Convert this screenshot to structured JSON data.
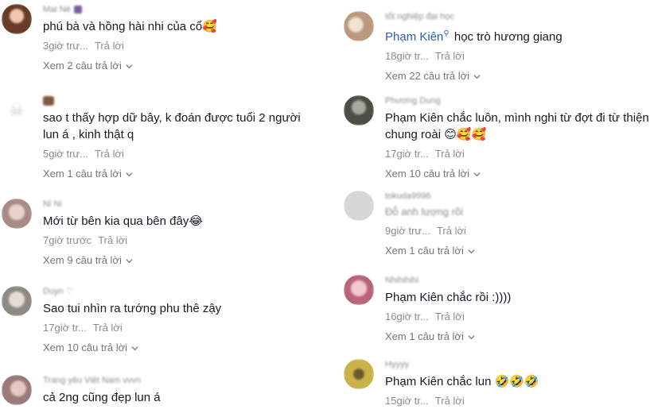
{
  "left_column": [
    {
      "username": "Mai Nè",
      "avatar_color": "#6b3b2a",
      "text": "phú bà và hồng hài nhi của cổ🥰",
      "time": "3giờ trư...",
      "reply_label": "Trả lời",
      "view_replies": "Xem 2 câu trả lời"
    },
    {
      "username": "",
      "avatar_color": "#d8d8d8",
      "text": "sao t thấy hợp dữ bây, k đoán được tuổi 2 người lun á , kinh thật q",
      "time": "5giờ trư...",
      "reply_label": "Trả lời",
      "view_replies": "Xem 1 câu trả lời"
    },
    {
      "username": "Ni Ni",
      "avatar_color": "#a88a86",
      "text": "Mới từ bên kia qua bên đây😂",
      "time": "7giờ trước",
      "reply_label": "Trả lời",
      "view_replies": "Xem 9 câu trả lời"
    },
    {
      "username": "Duyn ♡",
      "avatar_color": "#8d8a84",
      "text": "Sao tui nhìn ra tướng phu thê zậy",
      "time": "17giờ tr...",
      "reply_label": "Trả lời",
      "view_replies": "Xem 10 câu trả lời"
    },
    {
      "username": "Trang yêu Việt Nam vvvn",
      "avatar_color": "#9a7b7a",
      "text": "cả 2ng cũng đẹp lun á",
      "time": "",
      "reply_label": "",
      "view_replies": ""
    }
  ],
  "right_column": [
    {
      "username": "tốt nghiệp đại học",
      "avatar_color": "#b99a7e",
      "mention": "Phạm Kiên",
      "mention_icon": "🔍",
      "text": "học trò hương giang",
      "time": "18giờ tr...",
      "reply_label": "Trả lời",
      "view_replies": "Xem 22 câu trả lời"
    },
    {
      "username": "Phương Dung",
      "avatar_color": "#4b4f45",
      "mention": "",
      "text": "Phạm Kiên chắc luôn, mình nghi từ đợt đi từ thiện chung roài 😊🥰🥰",
      "time": "17giờ tr...",
      "reply_label": "Trả lời",
      "view_replies": "Xem 10 câu trả lời"
    },
    {
      "username": "tokuda9996",
      "avatar_color": "#cfcfcf",
      "mention": "",
      "text": "Đỗ anh lượng rồi",
      "time": "9giờ trư...",
      "reply_label": "Trả lời",
      "view_replies": "Xem 1 câu trả lời"
    },
    {
      "username": "Nhihihihi",
      "avatar_color": "#b8657a",
      "mention": "",
      "text": "Phạm Kiên chắc rồi :))))",
      "time": "16giờ tr...",
      "reply_label": "Trả lời",
      "view_replies": "Xem 1 câu trả lời"
    },
    {
      "username": "Hyyyy",
      "avatar_color": "#c9b348",
      "mention": "",
      "text": "Phạm Kiên chắc lun 🤣🤣🤣",
      "time": "15giờ tr...",
      "reply_label": "Trả lời",
      "view_replies": ""
    }
  ]
}
